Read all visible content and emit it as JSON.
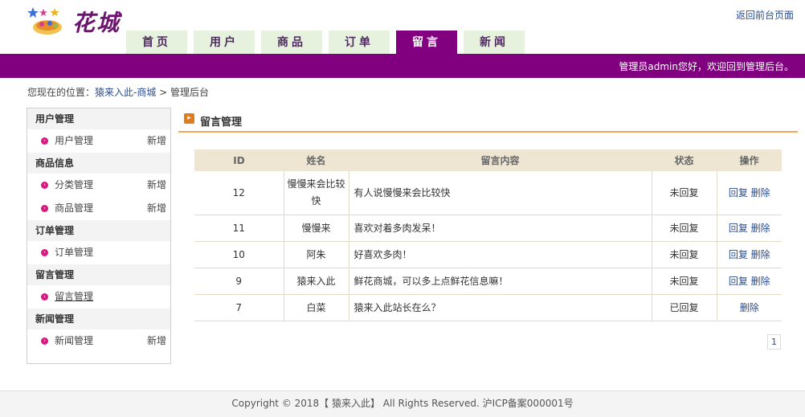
{
  "header": {
    "brand": "花城",
    "frontend_link": "返回前台页面",
    "welcome": "管理员admin您好，欢迎回到管理后台。",
    "nav": [
      {
        "label": "首页",
        "active": false
      },
      {
        "label": "用户",
        "active": false
      },
      {
        "label": "商品",
        "active": false
      },
      {
        "label": "订单",
        "active": false
      },
      {
        "label": "留言",
        "active": true
      },
      {
        "label": "新闻",
        "active": false
      }
    ]
  },
  "breadcrumb": {
    "prefix": "您现在的位置：",
    "site": "猿来入此-商城",
    "separator": " > ",
    "current": "管理后台"
  },
  "sidebar": {
    "add_label": "新增",
    "groups": [
      {
        "title": "用户管理",
        "items": [
          {
            "label": "用户管理",
            "add": true
          }
        ]
      },
      {
        "title": "商品信息",
        "items": [
          {
            "label": "分类管理",
            "add": true
          },
          {
            "label": "商品管理",
            "add": true
          }
        ]
      },
      {
        "title": "订单管理",
        "items": [
          {
            "label": "订单管理",
            "add": false
          }
        ]
      },
      {
        "title": "留言管理",
        "items": [
          {
            "label": "留言管理",
            "add": false,
            "current": true
          }
        ]
      },
      {
        "title": "新闻管理",
        "items": [
          {
            "label": "新闻管理",
            "add": true
          }
        ]
      }
    ]
  },
  "main": {
    "title": "留言管理",
    "table": {
      "headers": [
        "ID",
        "姓名",
        "留言内容",
        "状态",
        "操作"
      ],
      "rows": [
        {
          "id": "12",
          "name": "慢慢来会比较快",
          "content": "有人说慢慢来会比较快",
          "status": "未回复",
          "reply": "回复",
          "delete": "删除"
        },
        {
          "id": "11",
          "name": "慢慢来",
          "content": "喜欢对着多肉发呆！",
          "status": "未回复",
          "reply": "回复",
          "delete": "删除"
        },
        {
          "id": "10",
          "name": "阿朱",
          "content": "好喜欢多肉！",
          "status": "未回复",
          "reply": "回复",
          "delete": "删除"
        },
        {
          "id": "9",
          "name": "猿来入此",
          "content": "鲜花商城，可以多上点鲜花信息嘛！",
          "status": "未回复",
          "reply": "回复",
          "delete": "删除"
        },
        {
          "id": "7",
          "name": "白菜",
          "content": "猿来入此站长在么？",
          "status": "已回复",
          "reply": "",
          "delete": "删除"
        }
      ]
    },
    "pager": {
      "current": "1"
    }
  },
  "footer": {
    "text": "Copyright © 2018【 猿来入此】 All Rights Reserved. 沪ICP备案000001号"
  }
}
